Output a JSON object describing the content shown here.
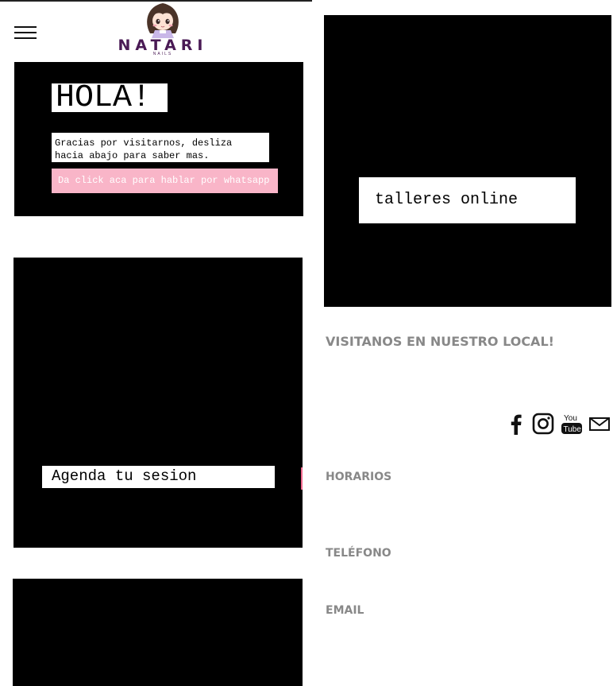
{
  "header": {
    "logo_text": "NATARI",
    "logo_subtext": "NAILS"
  },
  "hero": {
    "title": "HOLA!",
    "subtitle": "Gracias por visitarnos, desliza hacia abajo para saber mas.",
    "whatsapp_button": "Da click aca para hablar por whatsapp"
  },
  "booking": {
    "button": "Agenda tu sesion"
  },
  "online": {
    "button": "talleres online"
  },
  "info": {
    "visit_heading": "VISITANOS EN NUESTRO LOCAL!",
    "hours_heading": "HORARIOS",
    "phone_heading": "TELÉFONO",
    "email_heading": "EMAIL"
  },
  "social": {
    "youtube_top": "You",
    "youtube_bottom": "Tube"
  },
  "colors": {
    "accent_pink": "#f9b5c8",
    "brand_purple": "#4a1a55",
    "heading_gray": "#888888"
  }
}
